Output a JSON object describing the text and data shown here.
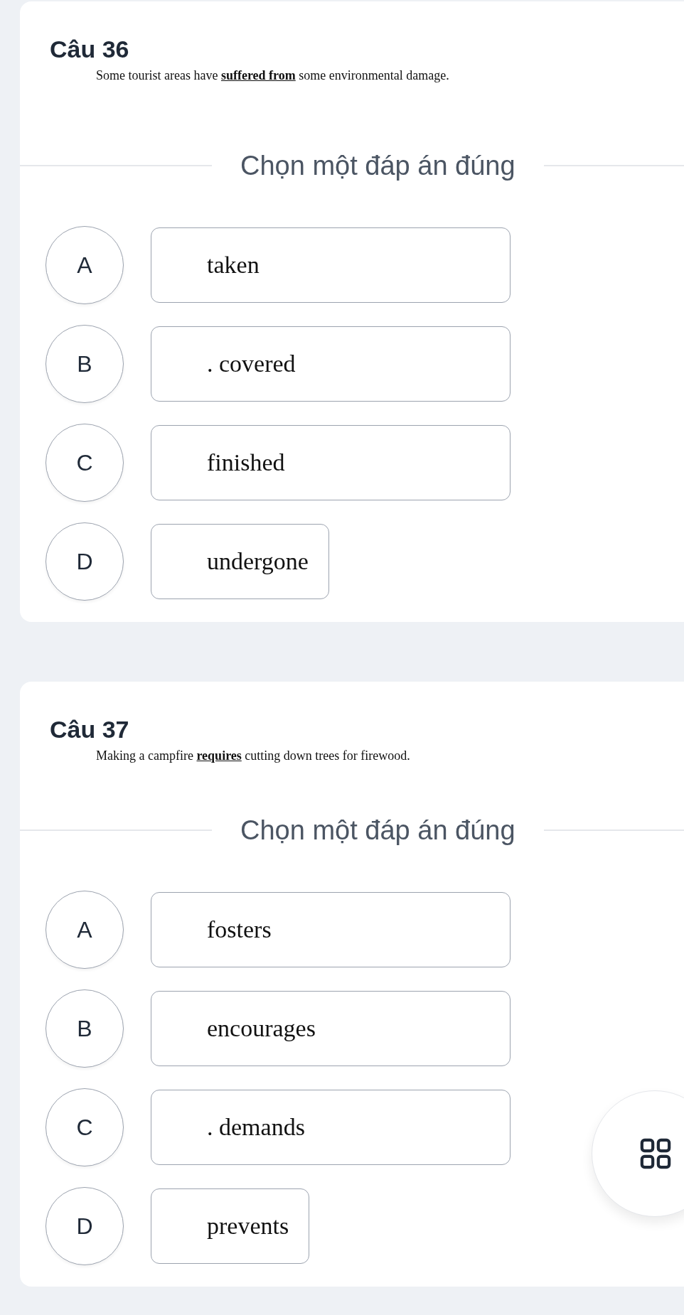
{
  "questions": [
    {
      "title": "Câu 36",
      "sentence": "Some tourist areas have **suffered from** some environmental damage.",
      "prompt": "Chọn một đáp án đúng",
      "options": [
        {
          "letter": "A",
          "text": "taken",
          "wide": true
        },
        {
          "letter": "B",
          "text": ". covered",
          "wide": true
        },
        {
          "letter": "C",
          "text": "finished",
          "wide": true
        },
        {
          "letter": "D",
          "text": "undergone",
          "wide": false
        }
      ]
    },
    {
      "title": "Câu 37",
      "sentence": "Making a campfire **requires** cutting down trees for firewood.",
      "prompt": "Chọn một đáp án đúng",
      "options": [
        {
          "letter": "A",
          "text": "fosters",
          "wide": true
        },
        {
          "letter": "B",
          "text": "encourages",
          "wide": true
        },
        {
          "letter": "C",
          "text": ". demands",
          "wide": true
        },
        {
          "letter": "D",
          "text": "prevents",
          "wide": false
        }
      ]
    }
  ]
}
